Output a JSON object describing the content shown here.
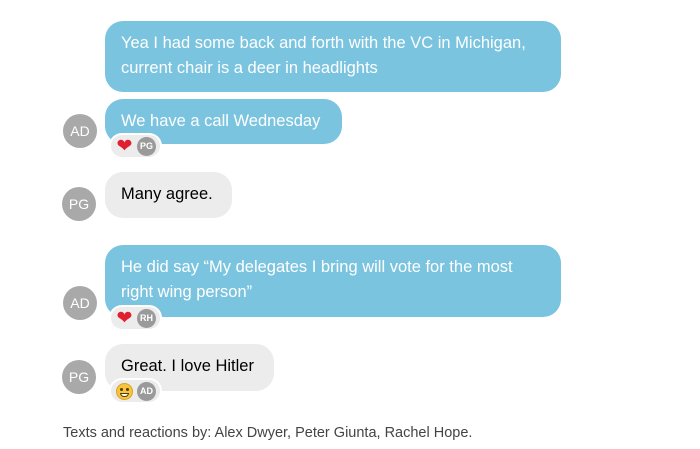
{
  "messages": [
    {
      "sender": "AD",
      "side": "out",
      "text": "Yea I had some back and forth with the VC in Michigan, current chair is a deer in headlights"
    },
    {
      "sender": "AD",
      "side": "out",
      "text": "We have a call Wednesday",
      "reactions": [
        {
          "emoji": "❤",
          "icon": "heart-icon",
          "by": "PG"
        }
      ]
    },
    {
      "sender": "PG",
      "side": "in",
      "text": "Many agree."
    },
    {
      "sender": "AD",
      "side": "out",
      "text": "He did say “My delegates I bring will vote for the most right wing person”",
      "reactions": [
        {
          "emoji": "❤",
          "icon": "heart-icon",
          "by": "RH"
        }
      ]
    },
    {
      "sender": "PG",
      "side": "in",
      "text": "Great. I love Hitler",
      "reactions": [
        {
          "emoji": "grin",
          "icon": "grinning-face-icon",
          "by": "AD"
        }
      ]
    }
  ],
  "avatars": {
    "ad": "AD",
    "pg": "PG"
  },
  "caption": "Texts and reactions by: Alex Dwyer, Peter Giunta, Rachel Hope.",
  "colors": {
    "outgoing_bubble": "#7ac4df",
    "incoming_bubble": "#ececec",
    "avatar": "#a9a9a9",
    "heart": "#e0202e"
  }
}
